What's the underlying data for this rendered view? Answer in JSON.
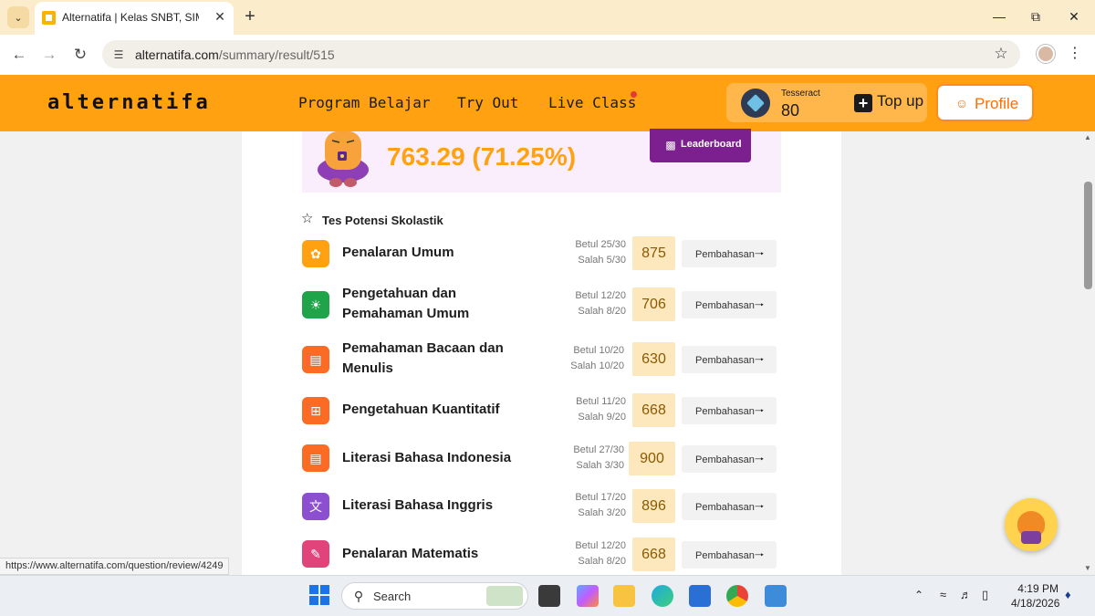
{
  "browser": {
    "tab_title": "Alternatifa | Kelas SNBT, SIMAK",
    "url_host": "alternatifa.com",
    "url_path": "/summary/result/515",
    "status_url": "https://www.alternatifa.com/question/review/4249",
    "icons": [
      "chevron-down-icon",
      "close-icon",
      "plus-icon",
      "back-arrow-icon",
      "forward-arrow-icon",
      "reload-icon",
      "site-info-icon",
      "star-icon",
      "kebab-menu-icon"
    ]
  },
  "site": {
    "logo": "alternatifa",
    "nav": [
      "Program Belajar",
      "Try Out",
      "Live Class"
    ],
    "wallet_label": "Tesseract",
    "wallet_value": "80",
    "topup_label": "Top up",
    "profile_label": "Profile",
    "accent_color": "#ffa110",
    "brand_purple": "#7c1f8f"
  },
  "result": {
    "total_score": "763.29 (71.25%)",
    "leaderboard_label": "Leaderboard",
    "section_title": "Tes Potensi Skolastik",
    "button_label": "Pembahasan",
    "subjects": [
      {
        "name": "Penalaran Umum",
        "betul": "Betul 25/30",
        "salah": "Salah 5/30",
        "score": "875",
        "icon": "brain-icon",
        "color": "#ffa110"
      },
      {
        "name": "Pengetahuan dan Pemahaman Umum",
        "betul": "Betul 12/20",
        "salah": "Salah 8/20",
        "score": "706",
        "icon": "lightbulb-icon",
        "color": "#1fa44a"
      },
      {
        "name": "Pemahaman Bacaan dan Menulis",
        "betul": "Betul 10/20",
        "salah": "Salah 10/20",
        "score": "630",
        "icon": "open-book-icon",
        "color": "#fb6b24"
      },
      {
        "name": "Pengetahuan Kuantitatif",
        "betul": "Betul 11/20",
        "salah": "Salah 9/20",
        "score": "668",
        "icon": "calculator-icon",
        "color": "#fb6b24"
      },
      {
        "name": "Literasi Bahasa Indonesia",
        "betul": "Betul 27/30",
        "salah": "Salah 3/30",
        "score": "900",
        "icon": "open-book-icon",
        "color": "#fb6b24"
      },
      {
        "name": "Literasi Bahasa Inggris",
        "betul": "Betul 17/20",
        "salah": "Salah 3/20",
        "score": "896",
        "icon": "translate-icon",
        "color": "#8b4fd0"
      },
      {
        "name": "Penalaran Matematis",
        "betul": "Betul 12/20",
        "salah": "Salah 8/20",
        "score": "668",
        "icon": "math-tools-icon",
        "color": "#e0447a"
      }
    ]
  },
  "taskbar": {
    "search_label": "Search",
    "time": "4:19 PM",
    "date": "4/18/2026"
  }
}
